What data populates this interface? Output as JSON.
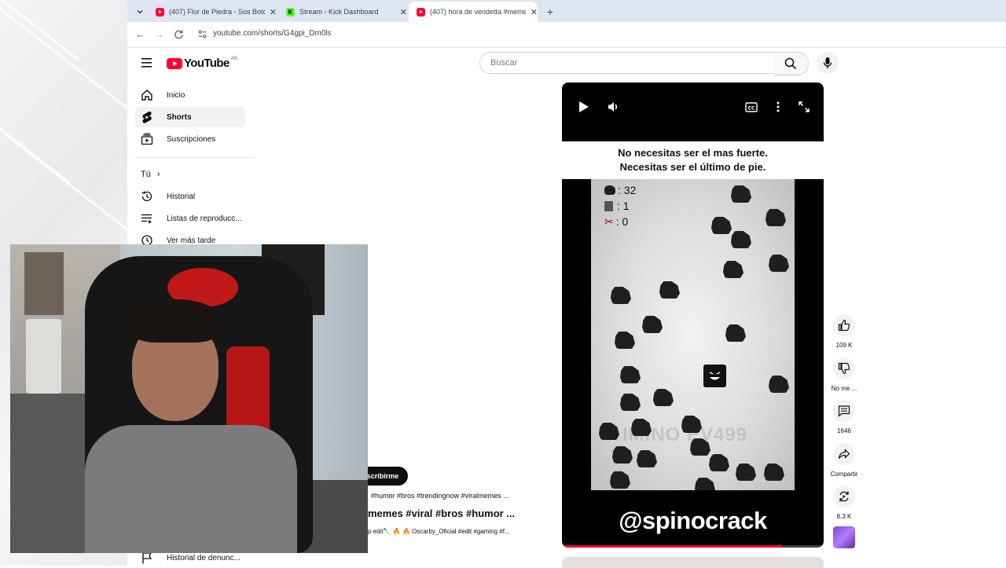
{
  "browser": {
    "tabs": [
      {
        "title": "(407) Flor de Piedra - Sos Botón",
        "favicon": "youtube"
      },
      {
        "title": "Stream - Kick Dashboard",
        "favicon": "kick"
      },
      {
        "title": "(407) hora de vendetta #memes",
        "favicon": "youtube",
        "active": true
      }
    ],
    "url": "youtube.com/shorts/G4gpi_Dm0ls"
  },
  "youtube": {
    "logo_text": "YouTube",
    "country_code": "AR",
    "search_placeholder": "Buscar"
  },
  "sidebar": {
    "items": [
      {
        "label": "Inicio",
        "icon": "home-icon"
      },
      {
        "label": "Shorts",
        "icon": "shorts-icon",
        "selected": true
      },
      {
        "label": "Suscripciones",
        "icon": "subscriptions-icon"
      }
    ],
    "you_header": "Tú",
    "you_items": [
      {
        "label": "Historial",
        "icon": "history-icon"
      },
      {
        "label": "Listas de reproducc...",
        "icon": "playlists-icon"
      },
      {
        "label": "Ver más tarde",
        "icon": "watch-later-icon"
      }
    ],
    "bottom_item": {
      "label": "Historial de denunc...",
      "icon": "flag-icon"
    }
  },
  "short": {
    "caption_line1": "No necesitas ser el mas fuerte.",
    "caption_line2": "Necesitas ser el último de pie.",
    "counters": [
      {
        "icon": "rock-icon",
        "value": ": 32"
      },
      {
        "icon": "paper-icon",
        "value": ": 1"
      },
      {
        "icon": "scissors-icon",
        "value": ": 0"
      }
    ],
    "handle": "@spinocrack",
    "progress": 0.84
  },
  "actions": [
    {
      "icon": "like-icon",
      "label": "109 K"
    },
    {
      "icon": "dislike-icon",
      "label": "No me ..."
    },
    {
      "icon": "comment-icon",
      "label": "1646"
    },
    {
      "icon": "share-icon",
      "label": "Compartir"
    },
    {
      "icon": "remix-icon",
      "label": "8,3 K"
    }
  ],
  "description": {
    "subscribe_label": "scribirme",
    "tags": "#humor #bros #trendingnow #viralmemes ...",
    "title": "memes #viral #bros #humor ...",
    "music": "p edit🔪 🔥 🔥 Oscarby_Oficial #edit #gaming #f..."
  }
}
